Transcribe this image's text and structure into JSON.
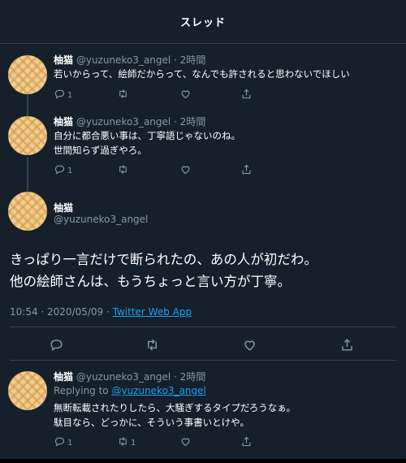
{
  "header": {
    "title": "スレッド"
  },
  "tweets": [
    {
      "name": "柚猫",
      "handle_time": "@yuzuneko3_angel · 2時間",
      "lines": [
        "若いからって、絵師だからって、なんでも許されると思わないでほしい"
      ],
      "reply_count": "1",
      "retweet_count": "",
      "like_count": ""
    },
    {
      "name": "柚猫",
      "handle_time": "@yuzuneko3_angel · 2時間",
      "lines": [
        "自分に都合悪い事は、丁寧語じゃないのね。",
        "世間知らず過ぎやろ。"
      ],
      "reply_count": "1",
      "retweet_count": "",
      "like_count": ""
    }
  ],
  "main_tweet": {
    "name": "柚猫",
    "handle": "@yuzuneko3_angel",
    "lines": [
      "きっぱり一言だけで断られたの、あの人が初だわ。",
      "他の絵師さんは、もうちょっと言い方が丁寧。"
    ],
    "timestamp": "10:54 · 2020/05/09 · ",
    "source": "Twitter Web App"
  },
  "reply_tweet": {
    "name": "柚猫",
    "handle_time": "@yuzuneko3_angel · 2時間",
    "replying_prefix": "Replying to ",
    "replying_to": "@yuzuneko3_angel",
    "lines": [
      "無断転載されたりしたら、大騒ぎするタイプだろうなぁ。",
      "駄目なら、どっかに、そういう事書いとけや。"
    ],
    "reply_count": "1",
    "retweet_count": "1",
    "like_count": ""
  },
  "colors": {
    "background": "#15202b",
    "secondary_text": "#8899a6",
    "link": "#1da1f2",
    "divider": "#38444d"
  },
  "icons": [
    "reply-icon",
    "retweet-icon",
    "like-icon",
    "share-icon"
  ]
}
